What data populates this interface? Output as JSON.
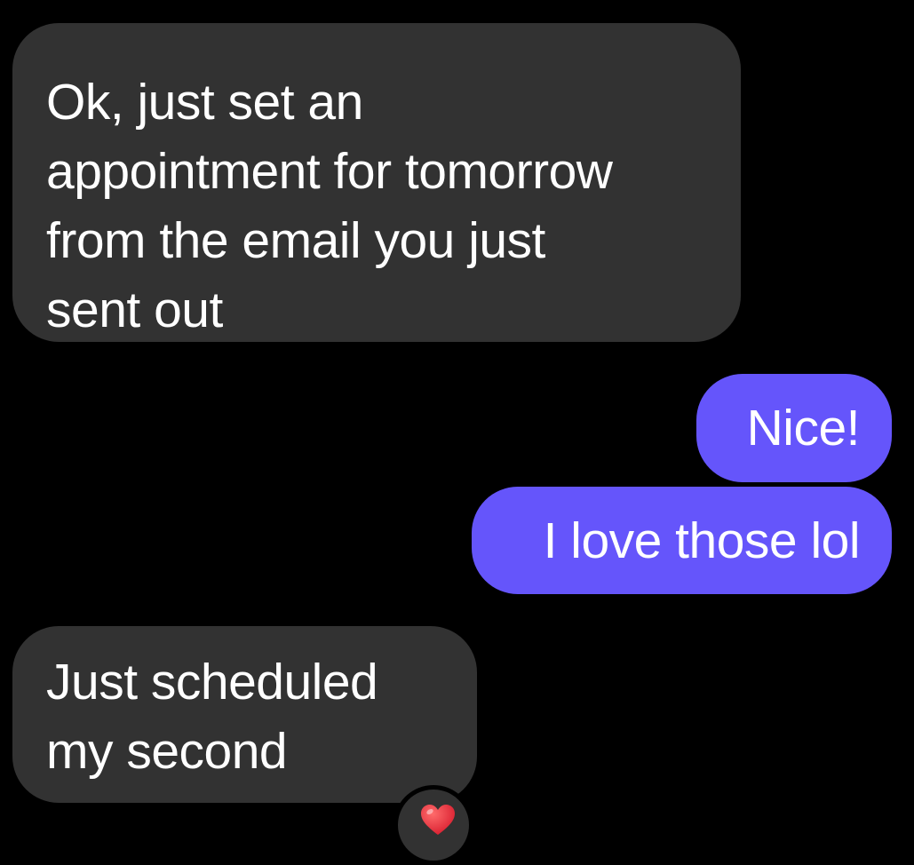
{
  "messages": [
    {
      "direction": "received",
      "text": "Ok, just set an\nappointment for tomorrow\nfrom the email you just\nsent out"
    },
    {
      "direction": "sent",
      "text": "Nice!"
    },
    {
      "direction": "sent",
      "text": "I love those lol"
    },
    {
      "direction": "received",
      "text": "Just scheduled\nmy second",
      "reaction": "heart-icon"
    }
  ],
  "colors": {
    "background": "#000000",
    "received_bubble": "#323232",
    "sent_bubble": "#6555fb",
    "text": "#ffffff",
    "heart": "#e8283a"
  }
}
